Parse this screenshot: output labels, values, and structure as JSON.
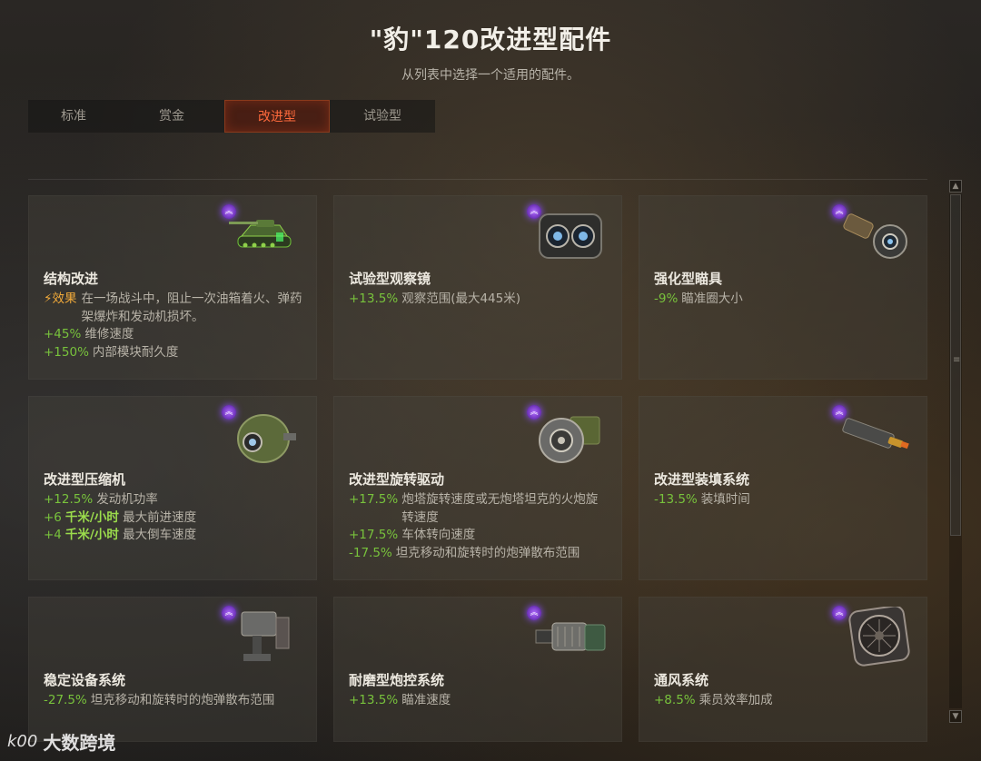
{
  "header": {
    "title": "\"豹\"120改进型配件",
    "subtitle": "从列表中选择一个适用的配件。"
  },
  "tabs": [
    {
      "label": "标准",
      "active": false
    },
    {
      "label": "赏金",
      "active": false
    },
    {
      "label": "改进型",
      "active": true
    },
    {
      "label": "试验型",
      "active": false
    }
  ],
  "colors": {
    "accent_active_tab": "#ff6a3c",
    "bonus_green": "#78c23c",
    "effect_orange": "#f0a93a",
    "rank_purple": "#8a4dff"
  },
  "cards": [
    {
      "name": "结构改进",
      "icon": "tank-icon",
      "effect": {
        "label": "效果",
        "text": "在一场战斗中，阻止一次油箱着火、弹药架爆炸和发动机损坏。"
      },
      "stats": [
        {
          "value": "+45%",
          "text": "维修速度"
        },
        {
          "value": "+150%",
          "text": "内部模块耐久度"
        }
      ]
    },
    {
      "name": "试验型观察镜",
      "icon": "binoculars-icon",
      "stats": [
        {
          "value": "+13.5%",
          "text": "观察范围(最大445米)"
        }
      ]
    },
    {
      "name": "强化型瞄具",
      "icon": "gun-sight-icon",
      "stats": [
        {
          "value": "-9%",
          "text": "瞄准圈大小"
        }
      ]
    },
    {
      "name": "改进型压缩机",
      "icon": "compressor-icon",
      "stats": [
        {
          "value": "+12.5%",
          "text": "发动机功率"
        },
        {
          "value": "+6",
          "unit": "千米/小时",
          "text": "最大前进速度"
        },
        {
          "value": "+4",
          "unit": "千米/小时",
          "text": "最大倒车速度"
        }
      ]
    },
    {
      "name": "改进型旋转驱动",
      "icon": "rotation-drive-icon",
      "stats": [
        {
          "value": "+17.5%",
          "text": "炮塔旋转速度或无炮塔坦克的火炮旋转速度"
        },
        {
          "value": "+17.5%",
          "text": "车体转向速度"
        },
        {
          "value": "-17.5%",
          "text": "坦克移动和旋转时的炮弹散布范围"
        }
      ]
    },
    {
      "name": "改进型装填系统",
      "icon": "shell-rammer-icon",
      "stats": [
        {
          "value": "-13.5%",
          "text": "装填时间"
        }
      ]
    },
    {
      "name": "稳定设备系统",
      "icon": "stabilizer-icon",
      "stats": [
        {
          "value": "-27.5%",
          "text": "坦克移动和旋转时的炮弹散布范围"
        }
      ]
    },
    {
      "name": "耐磨型炮控系统",
      "icon": "gun-laying-drive-icon",
      "stats": [
        {
          "value": "+13.5%",
          "text": "瞄准速度"
        }
      ]
    },
    {
      "name": "通风系统",
      "icon": "ventilation-fan-icon",
      "stats": [
        {
          "value": "+8.5%",
          "text": "乘员效率加成"
        }
      ]
    }
  ],
  "watermark": {
    "logo": "k00",
    "text": "大数跨境"
  }
}
